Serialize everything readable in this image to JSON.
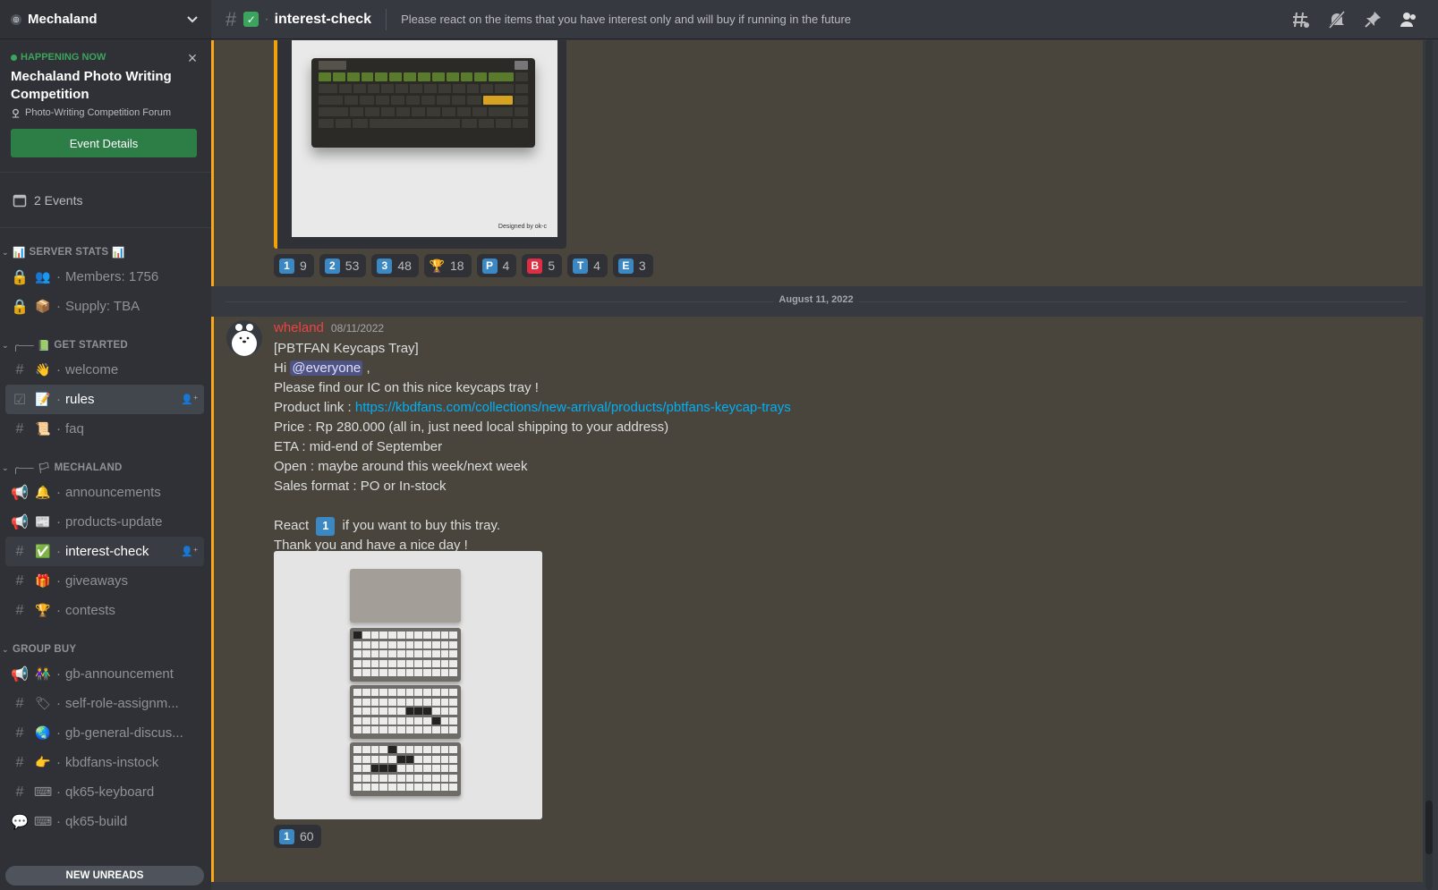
{
  "server": {
    "name": "Mechaland"
  },
  "event": {
    "status": "HAPPENING NOW",
    "title": "Mechaland Photo Writing Competition",
    "location": "Photo-Writing Competition Forum",
    "button": "Event Details"
  },
  "events_count": "2 Events",
  "categories": {
    "server_stats": "SERVER STATS",
    "get_started": "GET STARTED",
    "mechaland": "MECHALAND",
    "group_buy": "GROUP BUY"
  },
  "channels": {
    "members": "Members: 1756",
    "supply": "Supply: TBA",
    "welcome": "welcome",
    "rules": "rules",
    "faq": "faq",
    "announcements": "announcements",
    "products_update": "products-update",
    "interest_check": "interest-check",
    "giveaways": "giveaways",
    "contests": "contests",
    "gb_announcement": "gb-announcement",
    "self_role": "self-role-assignm...",
    "gb_general": "gb-general-discus...",
    "kbdfans_instock": "kbdfans-instock",
    "qk65_keyboard": "qk65-keyboard",
    "qk65_build": "qk65-build"
  },
  "new_unreads": "NEW UNREADS",
  "topbar": {
    "channel": "interest-check",
    "topic": "Please react on the items that you have interest only and will buy if running in the future"
  },
  "image_credit": "Designed by ok-c",
  "reactions_top": [
    {
      "key": "1",
      "count": "9"
    },
    {
      "key": "2",
      "count": "53"
    },
    {
      "key": "3",
      "count": "48"
    },
    {
      "key": "trophy",
      "count": "18"
    },
    {
      "key": "P",
      "count": "4"
    },
    {
      "key": "B",
      "count": "5"
    },
    {
      "key": "T",
      "count": "4"
    },
    {
      "key": "E",
      "count": "3"
    }
  ],
  "date_divider": "August 11, 2022",
  "message": {
    "author": "wheland",
    "timestamp": "08/11/2022",
    "lines": {
      "l1": "[PBTFAN Keycaps Tray]",
      "l2_pre": "Hi ",
      "mention": "@everyone",
      "l2_post": " ,",
      "l3": "Please find our IC on this nice keycaps tray !",
      "l4_pre": "Product link : ",
      "link": "https://kbdfans.com/collections/new-arrival/products/pbtfans-keycap-trays",
      "l5": "Price : Rp 280.000 (all in, just need local shipping to your address)",
      "l6": "ETA : mid-end of September",
      "l7": "Open : maybe around this week/next week",
      "l8": "Sales format : PO or In-stock",
      "l9_pre": "React ",
      "l9_key": "1",
      "l9_post": " if you want to buy this tray.",
      "l10": "Thank you and have a nice day !"
    }
  },
  "reactions_bottom": [
    {
      "key": "1",
      "count": "60"
    }
  ],
  "colors": {
    "accent_green": "#3ba55d",
    "highlight_border": "#faa81a",
    "link": "#00aff4",
    "author": "#ed4245"
  }
}
